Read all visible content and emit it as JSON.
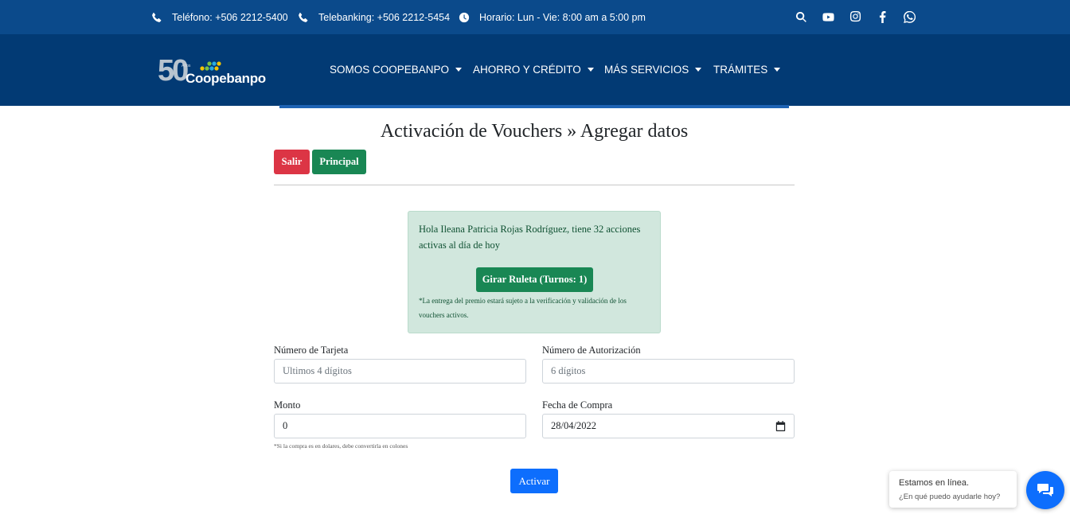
{
  "topbar": {
    "phone": "Teléfono: +506 2212-5400",
    "telebanking": "Telebanking: +506 2212-5454",
    "hours": "Horario: Lun - Vie: 8:00 am a 5:00 pm",
    "icons": [
      "search-icon",
      "youtube-icon",
      "instagram-icon",
      "facebook-icon",
      "whatsapp-icon"
    ]
  },
  "brand": {
    "logo_number": "50",
    "logo_years": "Años",
    "logo_name": "Coopebanpo"
  },
  "nav": {
    "items": [
      {
        "label": "SOMOS COOPEBANPO"
      },
      {
        "label": "AHORRO Y CRÉDITO"
      },
      {
        "label": "MÁS SERVICIOS"
      },
      {
        "label": "TRÁMITES"
      }
    ]
  },
  "page": {
    "title": "Activación de Vouchers » Agregar datos",
    "exit_label": "Salir",
    "main_label": "Principal"
  },
  "alert": {
    "greeting": "Hola Ileana Patricia Rojas Rodríguez, tiene 32 acciones activas al día de hoy",
    "spin_label": "Girar Ruleta (Turnos: 1)",
    "note": "*La entrega del premio estará sujeto a la verificación y validación de los vouchers activos."
  },
  "form": {
    "card_label": "Número de Tarjeta",
    "card_placeholder": "Ultimos 4 dígitos",
    "auth_label": "Número de Autorización",
    "auth_placeholder": "6 dígitos",
    "amount_label": "Monto",
    "amount_value": "0",
    "date_label": "Fecha de Compra",
    "date_value": "28/04/2022",
    "amount_hint": "*Si la compra es en dolares, debe convertirla en colones",
    "submit_label": "Activar"
  },
  "chat": {
    "status": "Estamos en línea.",
    "prompt": "¿En qué puedo ayudarle hoy?"
  },
  "colors": {
    "topbar": "#0b4a8b",
    "navbar": "#023a74",
    "danger": "#dc3545",
    "success": "#198754",
    "primary": "#0d6efd",
    "alert_bg": "#d1e7dd"
  }
}
